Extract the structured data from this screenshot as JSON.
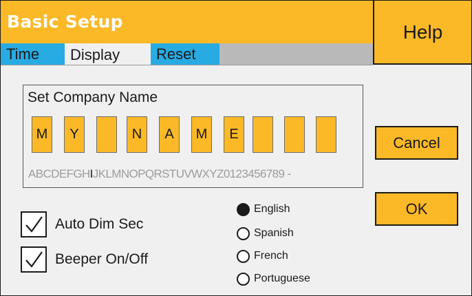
{
  "window": {
    "title": "Basic Setup",
    "help_label": "Help"
  },
  "tabs": [
    {
      "label": "Time",
      "active": false
    },
    {
      "label": "Display",
      "active": true
    },
    {
      "label": "Reset",
      "active": false
    }
  ],
  "company": {
    "label": "Set Company Name",
    "characters": [
      "M",
      "Y",
      "",
      "N",
      "A",
      "M",
      "E",
      "",
      "",
      ""
    ],
    "charset_before": "ABCDEFGH",
    "charset_selected": "I",
    "charset_after": "JKLMNOPQRSTUVWXYZ0123456789 -"
  },
  "buttons": {
    "cancel_label": "Cancel",
    "ok_label": "OK"
  },
  "options": [
    {
      "label": "Auto Dim Sec",
      "checked": true
    },
    {
      "label": "Beeper On/Off",
      "checked": true
    }
  ],
  "languages": {
    "items": [
      "English",
      "Spanish",
      "French",
      "Portuguese"
    ],
    "selected": "English"
  },
  "colors": {
    "accent": "#fbb927",
    "tab_blue": "#28abe2",
    "tab_strip": "#b9b9b9",
    "background": "#f0f0f0"
  }
}
